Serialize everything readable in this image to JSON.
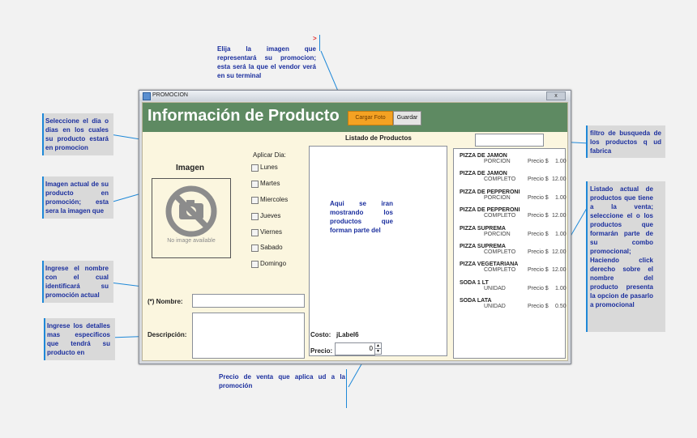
{
  "window": {
    "title": "PROMOCION",
    "close_label": "x"
  },
  "header": {
    "title": "Información de Producto",
    "cargar_foto": "Cargar Foto",
    "guardar": "Guardar"
  },
  "form": {
    "imagen_label": "Imagen",
    "no_image_text": "No image available",
    "aplicar_dia_label": "Aplicar Dia:",
    "days": [
      "Lunes",
      "Martes",
      "Miercoles",
      "Jueves",
      "Viernes",
      "Sabado",
      "Domingo"
    ],
    "nombre_label": "(*) Nombre:",
    "nombre_value": "",
    "descripcion_label": "Descripción:",
    "descripcion_value": "",
    "listado_label": "Listado de Productos",
    "costo_label": "Costo:",
    "costo_value": "jLabel6",
    "precio_label": "Precio:",
    "precio_value": "0",
    "filtro_value": ""
  },
  "products": [
    {
      "name": "PIZZA DE JAMON",
      "unit": "PORCION",
      "price_label": "Precio $",
      "price": "1.00"
    },
    {
      "name": "PIZZA DE JAMON",
      "unit": "COMPLETO",
      "price_label": "Precio $",
      "price": "12.00"
    },
    {
      "name": "PIZZA DE PEPPERONI",
      "unit": "PORCION",
      "price_label": "Precio $",
      "price": "1.00"
    },
    {
      "name": "PIZZA DE PEPPERONI",
      "unit": "COMPLETO",
      "price_label": "Precio $",
      "price": "12.00"
    },
    {
      "name": "PIZZA SUPREMA",
      "unit": "PORCION",
      "price_label": "Precio $",
      "price": "1.00"
    },
    {
      "name": "PIZZA SUPREMA",
      "unit": "COMPLETO",
      "price_label": "Precio $",
      "price": "12.00"
    },
    {
      "name": "PIZZA VEGETARIANA",
      "unit": "COMPLETO",
      "price_label": "Precio $",
      "price": "12.00"
    },
    {
      "name": "SODA 1 LT",
      "unit": "UNIDAD",
      "price_label": "Precio $",
      "price": "1.00"
    },
    {
      "name": "SODA LATA",
      "unit": "UNIDAD",
      "price_label": "Precio $",
      "price": "0.50"
    }
  ],
  "annotations": {
    "marker": ">",
    "elija": "Elija la imagen que representará su promocion; esta será la que el vendor verá en su terminal",
    "dia": "Seleccione el dia o dias en los cuales su producto estará en promocion",
    "imagen": "Imagen actual de su producto en promoción; esta sera la imagen que",
    "nombre": "Ingrese el nombre con el cual identificará su promoción actual",
    "detalles": "Ingrese los detalles mas especificos que tendrá su producto en",
    "aqui": "Aqui se iran mostrando los productos que forman parte del",
    "filtro": "filtro de busqueda de los productos q ud fabrica",
    "listado": "Listado actual de productos que tiene a la venta; seleccione el o los productos que formarán parte de su combo promocional; Haciendo click derecho sobre el nombre del producto presenta la opcion de pasarlo a promocional",
    "precio": "Precio de venta que aplica ud a la promoción"
  }
}
